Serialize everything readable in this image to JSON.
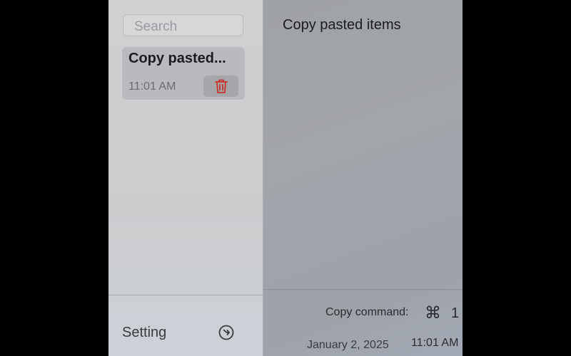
{
  "sidebar": {
    "search": {
      "placeholder": "Search",
      "value": ""
    },
    "notes": [
      {
        "title": "Copy pasted...",
        "time": "11:01 AM",
        "delete_icon": "trash-icon"
      }
    ],
    "setting_label": "Setting",
    "setting_icon": "circle-arrow-icon"
  },
  "main": {
    "title": "Copy pasted items",
    "copy_command_label": "Copy command:",
    "command_icon": "⌘",
    "command_key": "1",
    "date": "January 2, 2025",
    "time": "11:01 AM"
  },
  "colors": {
    "delete_icon": "#c8322c",
    "sidebar_bg": "#cfd0d2",
    "main_bg": "#a0a3a8"
  }
}
